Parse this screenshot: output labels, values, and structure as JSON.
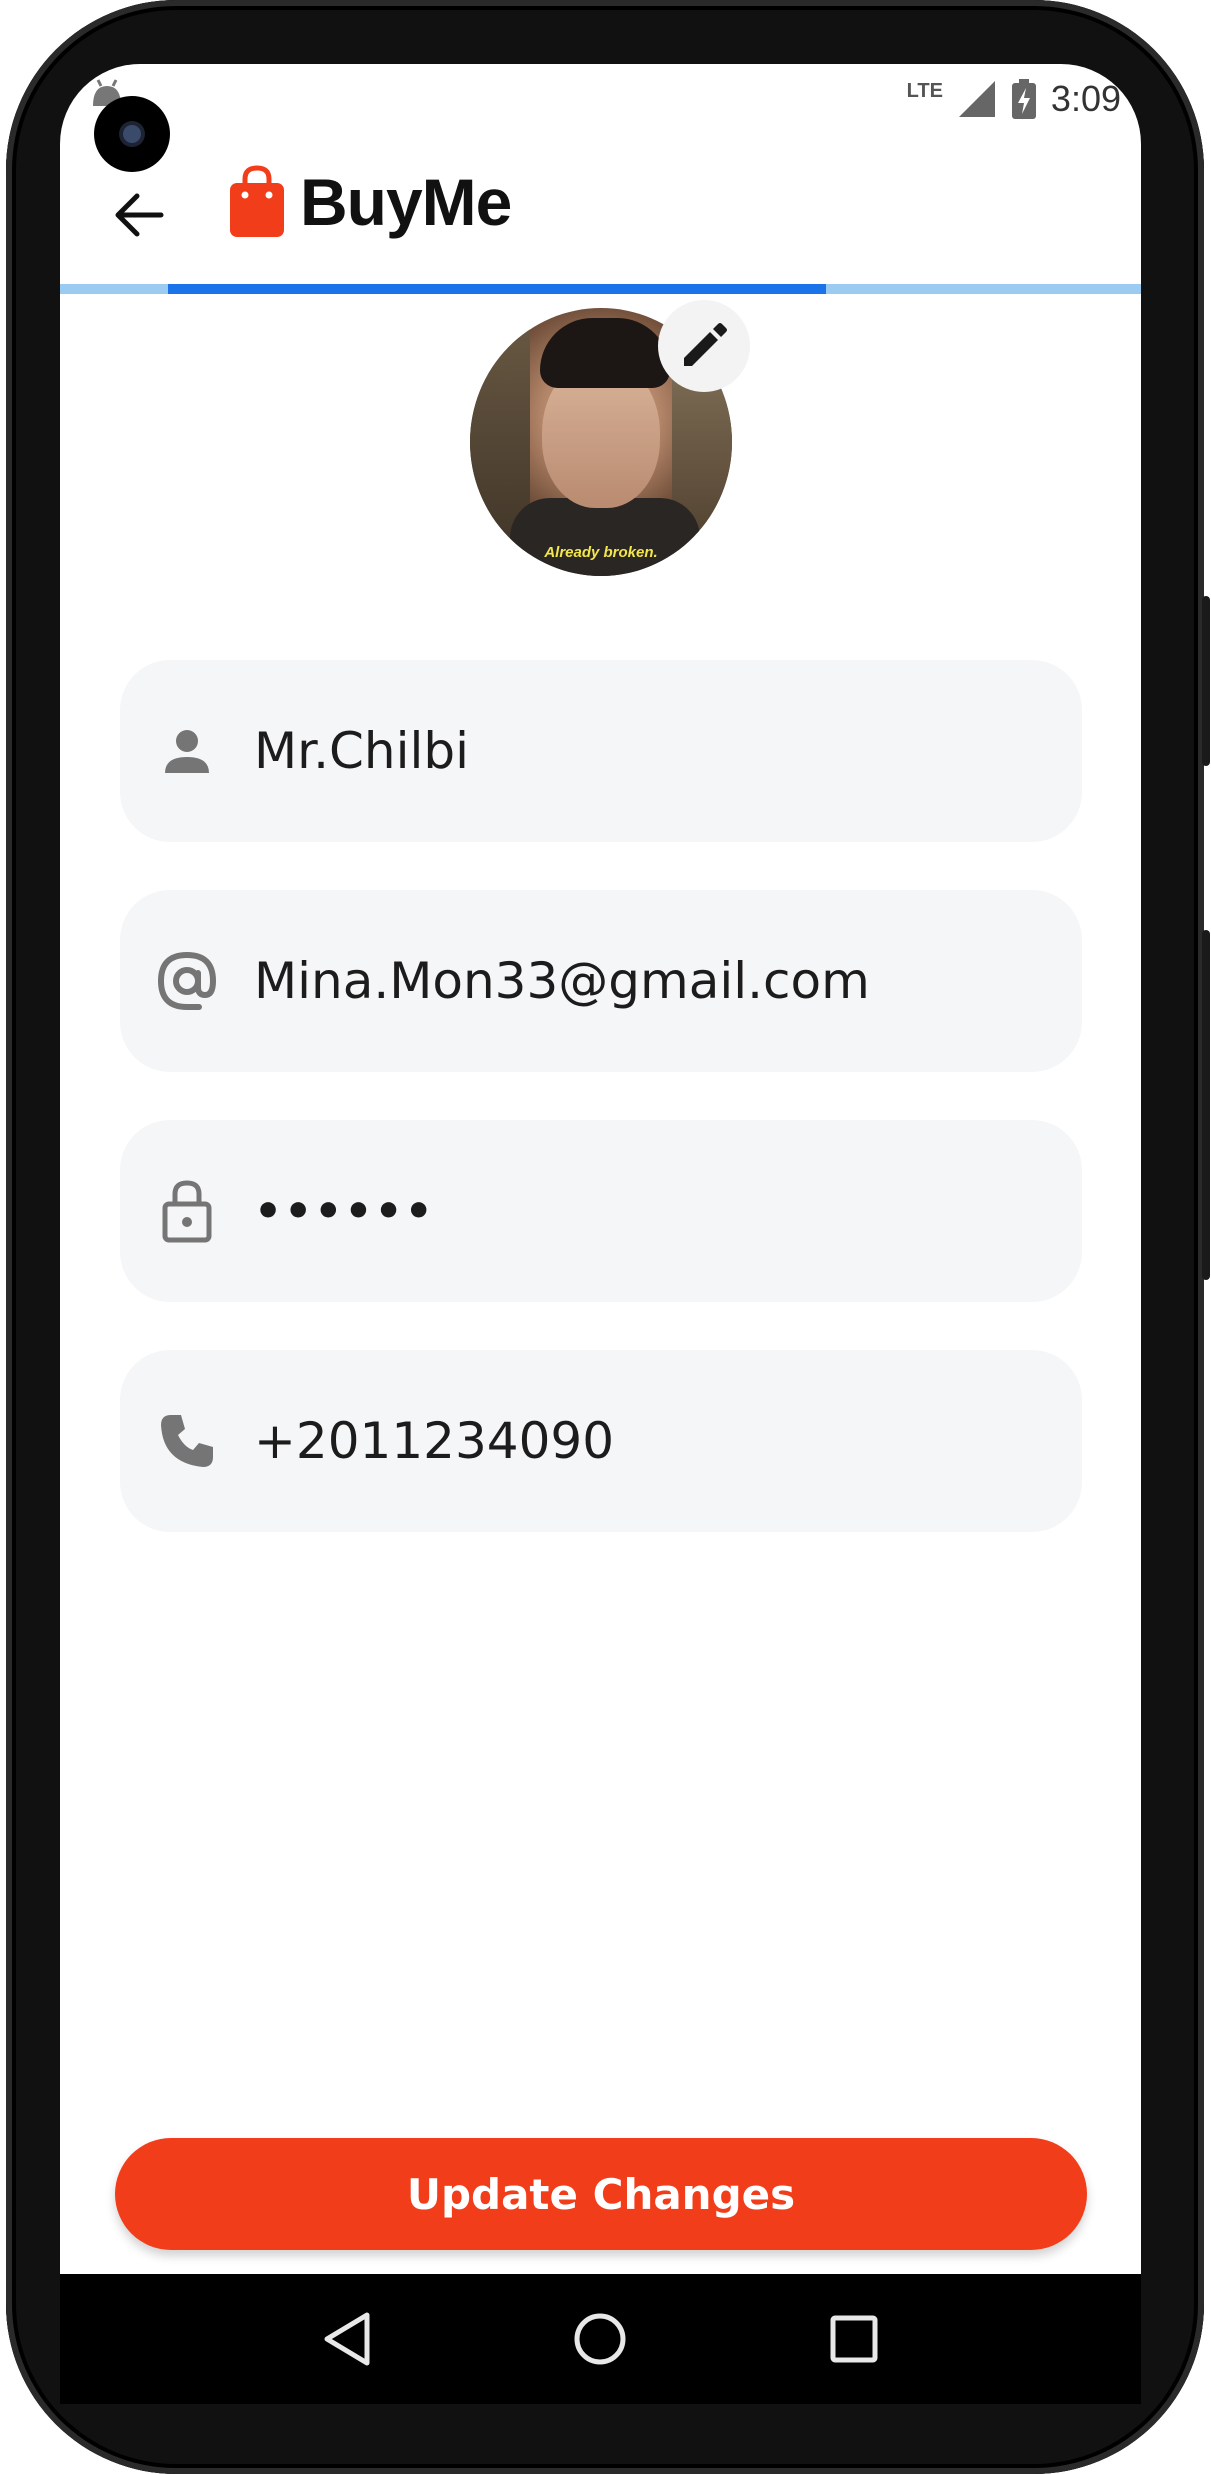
{
  "status_bar": {
    "network": "LTE",
    "time": "3:09"
  },
  "app_bar": {
    "title": "BuyMe",
    "icons": {
      "back": "back-arrow-icon",
      "logo": "shopping-bag-icon"
    }
  },
  "progress": {
    "fraction": 0.609,
    "track_color": "#9ccbf2",
    "fill_color": "#1a73e8"
  },
  "profile": {
    "avatar_caption": "Already broken.",
    "edit_icon": "pencil-icon"
  },
  "fields": {
    "name": {
      "value": "Mr.Chilbi",
      "icon": "person-icon"
    },
    "email": {
      "value": "Mina.Mon33@gmail.com",
      "icon": "at-sign-icon"
    },
    "password": {
      "value": "••••••",
      "icon": "lock-icon"
    },
    "phone": {
      "value": "+2011234090",
      "icon": "phone-icon"
    }
  },
  "actions": {
    "update_label": "Update Changes"
  },
  "colors": {
    "accent": "#f13d1a",
    "field_bg": "#f5f6f8"
  },
  "nav_bar": {
    "icons": [
      "back-triangle-icon",
      "home-circle-icon",
      "recents-square-icon"
    ]
  }
}
